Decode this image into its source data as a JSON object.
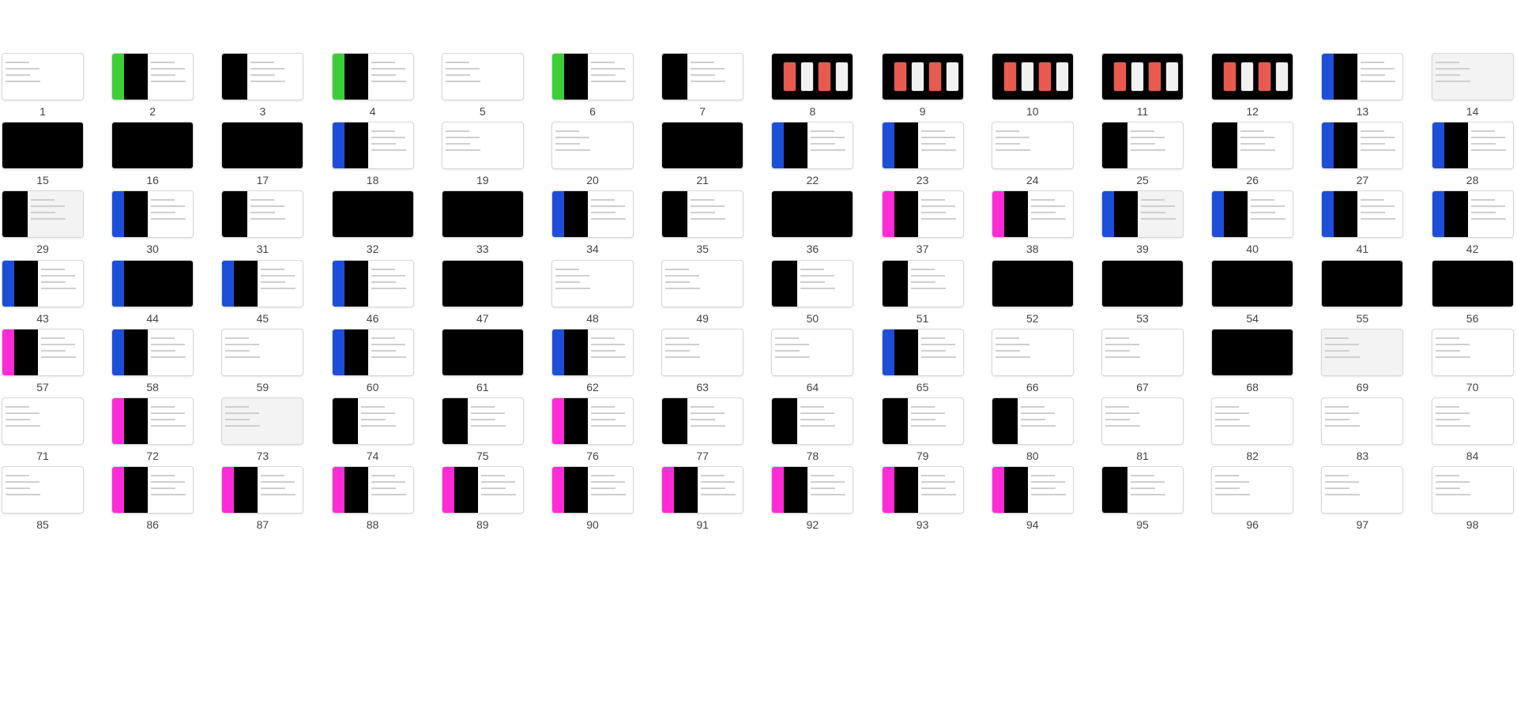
{
  "slides": [
    {
      "num": "1",
      "bg": "white",
      "band": "none"
    },
    {
      "num": "2",
      "bg": "white",
      "band": "#3ccf37"
    },
    {
      "num": "3",
      "bg": "white",
      "band": "none",
      "panel": true
    },
    {
      "num": "4",
      "bg": "white",
      "band": "#3ccf37"
    },
    {
      "num": "5",
      "bg": "white",
      "band": "none"
    },
    {
      "num": "6",
      "bg": "white",
      "band": "#3ccf37"
    },
    {
      "num": "7",
      "bg": "white",
      "band": "none",
      "panel": true
    },
    {
      "num": "8",
      "bg": "black",
      "band": "none"
    },
    {
      "num": "9",
      "bg": "black",
      "band": "none"
    },
    {
      "num": "10",
      "bg": "black",
      "band": "none"
    },
    {
      "num": "11",
      "bg": "black",
      "band": "none"
    },
    {
      "num": "12",
      "bg": "black",
      "band": "none"
    },
    {
      "num": "13",
      "bg": "white",
      "band": "#1d4ed8"
    },
    {
      "num": "14",
      "bg": "lgray",
      "band": "none"
    },
    {
      "num": "15",
      "bg": "black",
      "band": "none"
    },
    {
      "num": "16",
      "bg": "black",
      "band": "none"
    },
    {
      "num": "17",
      "bg": "black",
      "band": "none"
    },
    {
      "num": "18",
      "bg": "white",
      "band": "#1d4ed8"
    },
    {
      "num": "19",
      "bg": "white",
      "band": "none"
    },
    {
      "num": "20",
      "bg": "white",
      "band": "none"
    },
    {
      "num": "21",
      "bg": "black",
      "band": "none"
    },
    {
      "num": "22",
      "bg": "white",
      "band": "#1d4ed8"
    },
    {
      "num": "23",
      "bg": "white",
      "band": "#1d4ed8"
    },
    {
      "num": "24",
      "bg": "white",
      "band": "none"
    },
    {
      "num": "25",
      "bg": "white",
      "band": "none",
      "panel": true
    },
    {
      "num": "26",
      "bg": "white",
      "band": "none",
      "panel": true
    },
    {
      "num": "27",
      "bg": "white",
      "band": "#1d4ed8"
    },
    {
      "num": "28",
      "bg": "white",
      "band": "#1d4ed8"
    },
    {
      "num": "29",
      "bg": "lgray",
      "band": "none",
      "panel": true
    },
    {
      "num": "30",
      "bg": "white",
      "band": "#1d4ed8"
    },
    {
      "num": "31",
      "bg": "white",
      "band": "none",
      "panel": true
    },
    {
      "num": "32",
      "bg": "black",
      "band": "none"
    },
    {
      "num": "33",
      "bg": "black",
      "band": "none"
    },
    {
      "num": "34",
      "bg": "white",
      "band": "#1d4ed8"
    },
    {
      "num": "35",
      "bg": "white",
      "band": "none",
      "panel": true
    },
    {
      "num": "36",
      "bg": "black",
      "band": "none"
    },
    {
      "num": "37",
      "bg": "white",
      "band": "#ff2bd6"
    },
    {
      "num": "38",
      "bg": "white",
      "band": "#ff2bd6"
    },
    {
      "num": "39",
      "bg": "lgray",
      "band": "#1d4ed8"
    },
    {
      "num": "40",
      "bg": "white",
      "band": "#1d4ed8"
    },
    {
      "num": "41",
      "bg": "white",
      "band": "#1d4ed8"
    },
    {
      "num": "42",
      "bg": "white",
      "band": "#1d4ed8"
    },
    {
      "num": "43",
      "bg": "white",
      "band": "#1d4ed8"
    },
    {
      "num": "44",
      "bg": "black",
      "band": "#1d4ed8"
    },
    {
      "num": "45",
      "bg": "white",
      "band": "#1d4ed8"
    },
    {
      "num": "46",
      "bg": "white",
      "band": "#1d4ed8"
    },
    {
      "num": "47",
      "bg": "black",
      "band": "none"
    },
    {
      "num": "48",
      "bg": "white",
      "band": "none"
    },
    {
      "num": "49",
      "bg": "white",
      "band": "none"
    },
    {
      "num": "50",
      "bg": "white",
      "band": "none",
      "panel": true
    },
    {
      "num": "51",
      "bg": "white",
      "band": "none",
      "panel": true
    },
    {
      "num": "52",
      "bg": "black",
      "band": "none"
    },
    {
      "num": "53",
      "bg": "black",
      "band": "none"
    },
    {
      "num": "54",
      "bg": "black",
      "band": "none"
    },
    {
      "num": "55",
      "bg": "black",
      "band": "none"
    },
    {
      "num": "56",
      "bg": "black",
      "band": "none"
    },
    {
      "num": "57",
      "bg": "white",
      "band": "#ff2bd6"
    },
    {
      "num": "58",
      "bg": "white",
      "band": "#1d4ed8"
    },
    {
      "num": "59",
      "bg": "white",
      "band": "none"
    },
    {
      "num": "60",
      "bg": "white",
      "band": "#1d4ed8"
    },
    {
      "num": "61",
      "bg": "black",
      "band": "none"
    },
    {
      "num": "62",
      "bg": "white",
      "band": "#1d4ed8"
    },
    {
      "num": "63",
      "bg": "white",
      "band": "none"
    },
    {
      "num": "64",
      "bg": "white",
      "band": "none"
    },
    {
      "num": "65",
      "bg": "white",
      "band": "#1d4ed8"
    },
    {
      "num": "66",
      "bg": "white",
      "band": "none"
    },
    {
      "num": "67",
      "bg": "white",
      "band": "none"
    },
    {
      "num": "68",
      "bg": "black",
      "band": "none"
    },
    {
      "num": "69",
      "bg": "lgray",
      "band": "none"
    },
    {
      "num": "70",
      "bg": "white",
      "band": "none"
    },
    {
      "num": "71",
      "bg": "white",
      "band": "none"
    },
    {
      "num": "72",
      "bg": "white",
      "band": "#ff2bd6"
    },
    {
      "num": "73",
      "bg": "lgray",
      "band": "none"
    },
    {
      "num": "74",
      "bg": "white",
      "band": "none",
      "panel": true
    },
    {
      "num": "75",
      "bg": "white",
      "band": "none",
      "panel": true
    },
    {
      "num": "76",
      "bg": "white",
      "band": "#ff2bd6"
    },
    {
      "num": "77",
      "bg": "white",
      "band": "none",
      "panel": true
    },
    {
      "num": "78",
      "bg": "white",
      "band": "none",
      "panel": true
    },
    {
      "num": "79",
      "bg": "white",
      "band": "none",
      "panel": true
    },
    {
      "num": "80",
      "bg": "white",
      "band": "none",
      "panel": true
    },
    {
      "num": "81",
      "bg": "white",
      "band": "none"
    },
    {
      "num": "82",
      "bg": "white",
      "band": "none"
    },
    {
      "num": "83",
      "bg": "white",
      "band": "none"
    },
    {
      "num": "84",
      "bg": "white",
      "band": "none"
    },
    {
      "num": "85",
      "bg": "white",
      "band": "none"
    },
    {
      "num": "86",
      "bg": "white",
      "band": "#ff2bd6"
    },
    {
      "num": "87",
      "bg": "white",
      "band": "#ff2bd6"
    },
    {
      "num": "88",
      "bg": "white",
      "band": "#ff2bd6"
    },
    {
      "num": "89",
      "bg": "white",
      "band": "#ff2bd6"
    },
    {
      "num": "90",
      "bg": "white",
      "band": "#ff2bd6"
    },
    {
      "num": "91",
      "bg": "white",
      "band": "#ff2bd6"
    },
    {
      "num": "92",
      "bg": "white",
      "band": "#ff2bd6"
    },
    {
      "num": "93",
      "bg": "white",
      "band": "#ff2bd6"
    },
    {
      "num": "94",
      "bg": "white",
      "band": "#ff2bd6"
    },
    {
      "num": "95",
      "bg": "white",
      "band": "none",
      "panel": true
    },
    {
      "num": "96",
      "bg": "white",
      "band": "none"
    },
    {
      "num": "97",
      "bg": "white",
      "band": "none"
    },
    {
      "num": "98",
      "bg": "white",
      "band": "none"
    }
  ]
}
